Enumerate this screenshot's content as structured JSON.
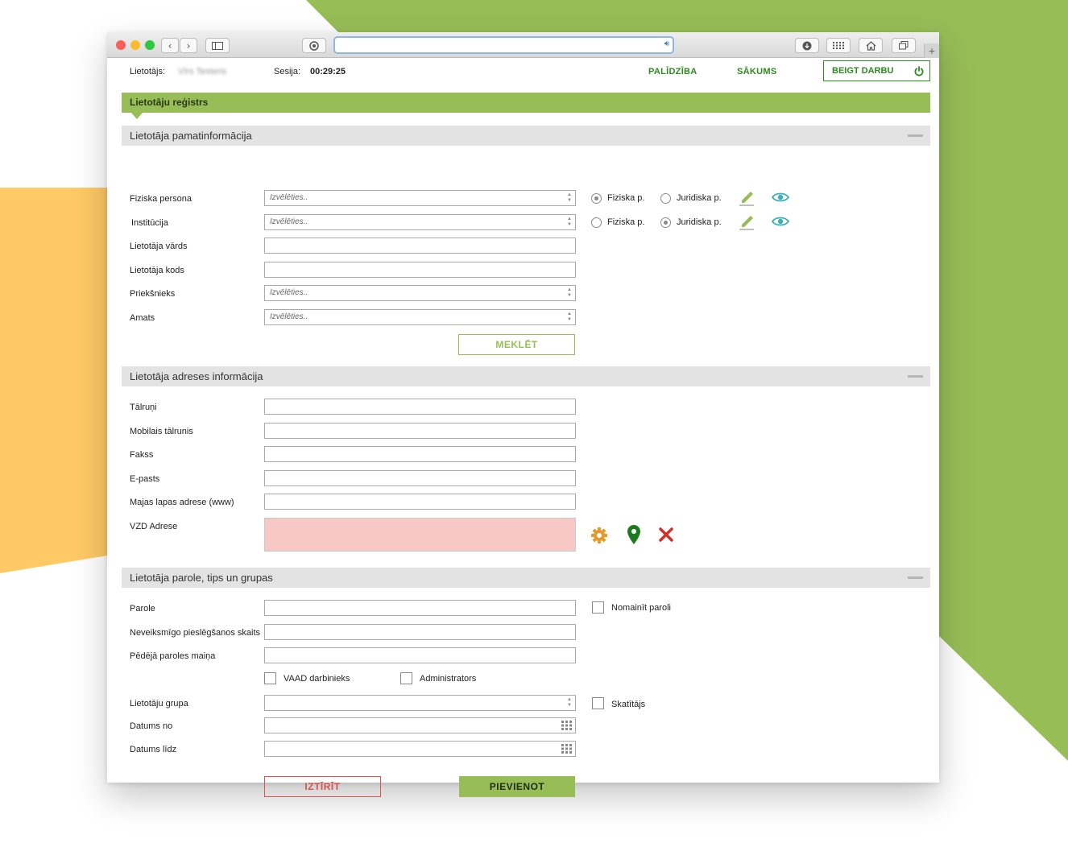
{
  "header": {
    "user_label": "Lietotājs:",
    "user_value": "Vīrs Testeris",
    "session_label": "Sesija:",
    "session_value": "00:29:25",
    "help_link": "PALĪDZĪBA",
    "home_link": "SĀKUMS",
    "logout_button": "BEIGT DARBU"
  },
  "page_title": "Lietotāju reģistrs",
  "placeholder_select": "Izvēlēties..",
  "section_basic": {
    "title": "Lietotāja pamatinformācija",
    "physical_person_label": "Fiziska persona",
    "institution_label": "Institūcija",
    "username_label": "Lietotāja vārds",
    "user_code_label": "Lietotāja kods",
    "supervisor_label": "Priekšnieks",
    "position_label": "Amats",
    "radio_physical": "Fiziska p.",
    "radio_legal": "Juridiska p.",
    "search_button": "MEKLĒT"
  },
  "section_address": {
    "title": "Lietotāja adreses informācija",
    "phones_label": "Tālruņi",
    "mobile_label": "Mobilais tālrunis",
    "fax_label": "Fakss",
    "email_label": "E-pasts",
    "website_label": "Majas lapas adrese (www)",
    "vzd_label": "VZD Adrese"
  },
  "section_password": {
    "title": "Lietotāja parole, tips un grupas",
    "password_label": "Parole",
    "failed_logins_label": "Neveiksmīgo pieslēgšanos skaits",
    "last_change_label": "Pēdējā paroles maiņa",
    "change_password_label": "Nomainīt paroli",
    "vaad_employee_label": "VAAD darbinieks",
    "administrator_label": "Administrators",
    "user_group_label": "Lietotāju grupa",
    "viewer_label": "Skatītājs",
    "date_from_label": "Datums no",
    "date_to_label": "Datums līdz",
    "clear_button": "IZTĪRĪT",
    "add_button": "PIEVIENOT"
  },
  "colors": {
    "accent_green": "#97bd57",
    "link_green": "#2e8a1e",
    "danger_red": "#d9534f",
    "error_fill": "#f8c8c6",
    "gear_orange": "#e59a2c",
    "eye_teal": "#3bb0b8"
  },
  "icons": [
    "back-icon",
    "forward-icon",
    "sidebar-icon",
    "reader-icon",
    "audio-icon",
    "download-icon",
    "apps-icon",
    "home-icon",
    "tabs-icon",
    "power-icon",
    "pencil-icon",
    "eye-icon",
    "gear-icon",
    "map-pin-icon",
    "close-icon",
    "calendar-icon"
  ]
}
